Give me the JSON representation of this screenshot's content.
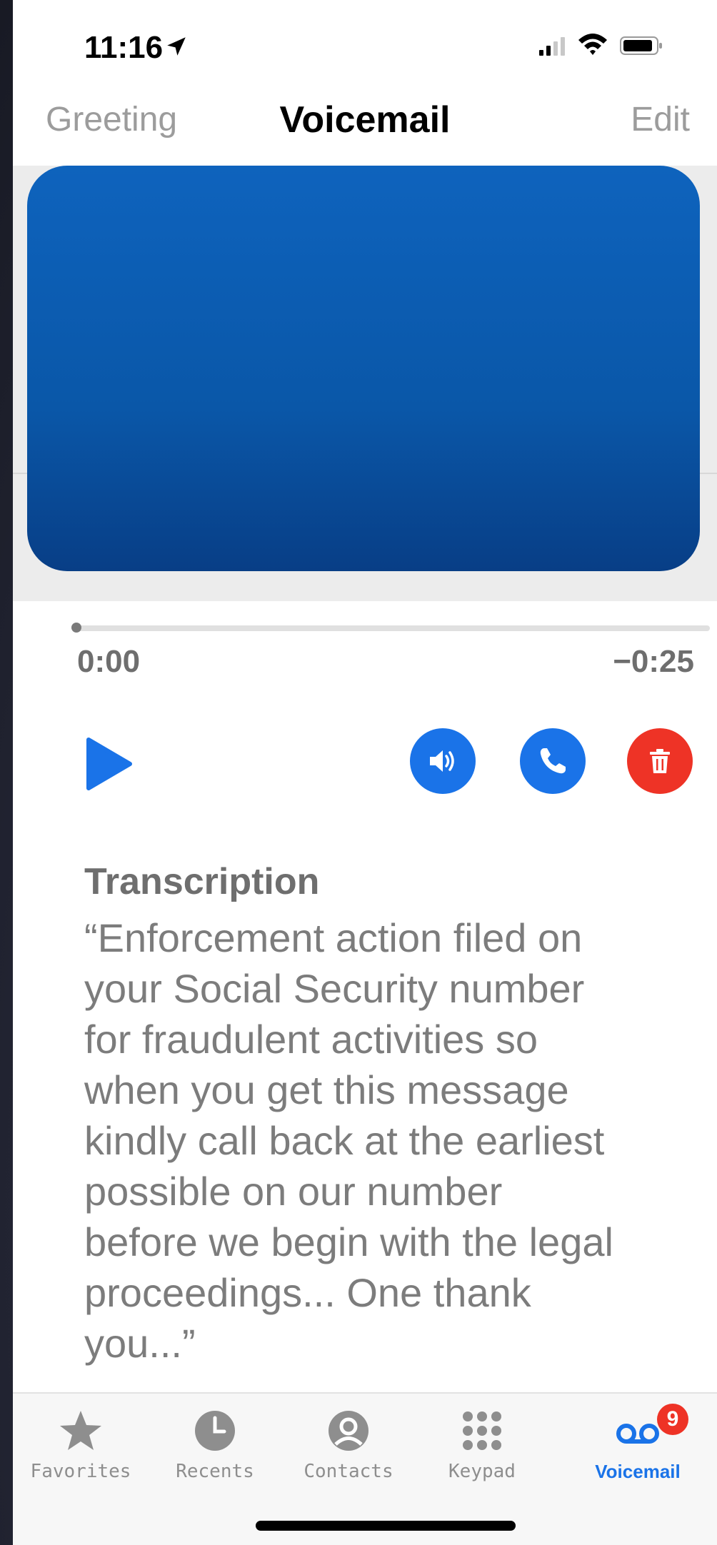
{
  "status_bar": {
    "time": "11:16"
  },
  "nav": {
    "left": "Greeting",
    "title": "Voicemail",
    "right": "Edit"
  },
  "player": {
    "elapsed": "0:00",
    "remaining": "−0:25",
    "progress_fraction": 0.0
  },
  "transcription": {
    "heading": "Transcription",
    "text": "“Enforcement action filed on\n your Social Security number\n for fraudulent activities so\n when you get this message\n kindly call back at the earliest\n possible on our number\n before we begin with the legal\n proceedings... One thank\n you...”"
  },
  "tabs": [
    {
      "label": "Favorites",
      "icon": "star-icon"
    },
    {
      "label": "Recents",
      "icon": "clock-icon"
    },
    {
      "label": "Contacts",
      "icon": "person-circle-icon"
    },
    {
      "label": "Keypad",
      "icon": "keypad-icon"
    },
    {
      "label": "Voicemail",
      "icon": "voicemail-icon",
      "active": true,
      "badge": "9"
    }
  ],
  "colors": {
    "accent": "#1a73e8",
    "destructive": "#ee3326",
    "redaction": "#0a57a8"
  }
}
